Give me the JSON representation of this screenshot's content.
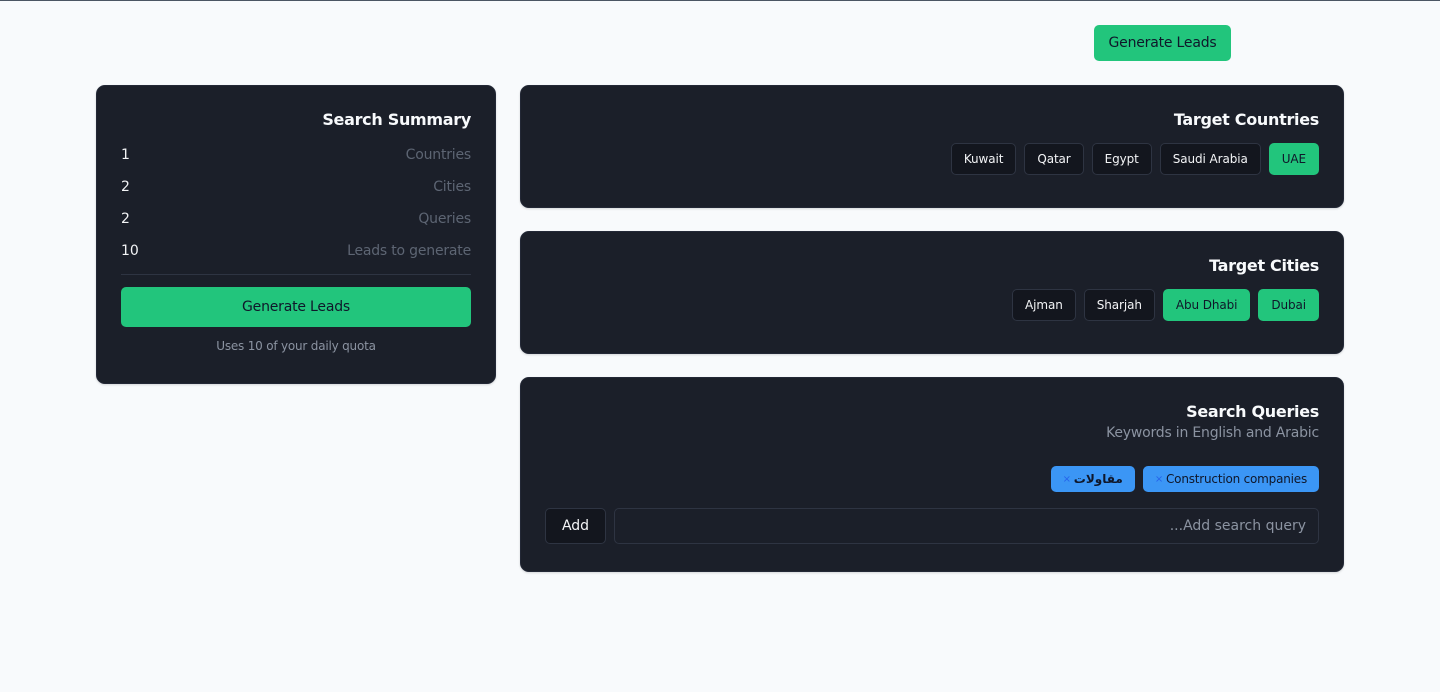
{
  "header": {
    "generate_label": "Generate Leads"
  },
  "summary": {
    "title": "Search Summary",
    "stats": [
      {
        "value": "1",
        "label": "Countries"
      },
      {
        "value": "2",
        "label": "Cities"
      },
      {
        "value": "2",
        "label": "Queries"
      },
      {
        "value": "10",
        "label": "Leads to generate"
      }
    ],
    "generate_label": "Generate Leads",
    "quota_text": "Uses 10 of your daily quota"
  },
  "countries": {
    "title": "Target Countries",
    "items": [
      {
        "label": "Kuwait",
        "selected": false
      },
      {
        "label": "Qatar",
        "selected": false
      },
      {
        "label": "Egypt",
        "selected": false
      },
      {
        "label": "Saudi Arabia",
        "selected": false
      },
      {
        "label": "UAE",
        "selected": true
      }
    ]
  },
  "cities": {
    "title": "Target Cities",
    "items": [
      {
        "label": "Ajman",
        "selected": false
      },
      {
        "label": "Sharjah",
        "selected": false
      },
      {
        "label": "Abu Dhabi",
        "selected": true
      },
      {
        "label": "Dubai",
        "selected": true
      }
    ]
  },
  "queries": {
    "title": "Search Queries",
    "subtitle": "Keywords in English and Arabic",
    "tags": [
      {
        "label": "مقاولات",
        "remove_glyph": "×"
      },
      {
        "label": "Construction companies",
        "remove_glyph": "×"
      }
    ],
    "add_label": "Add",
    "input_placeholder": "...Add search query",
    "input_value": ""
  },
  "colors": {
    "background": "#f8fafc",
    "card": "#1b1f29",
    "accent_green": "#22c57c",
    "tag_blue": "#3b96f5"
  }
}
